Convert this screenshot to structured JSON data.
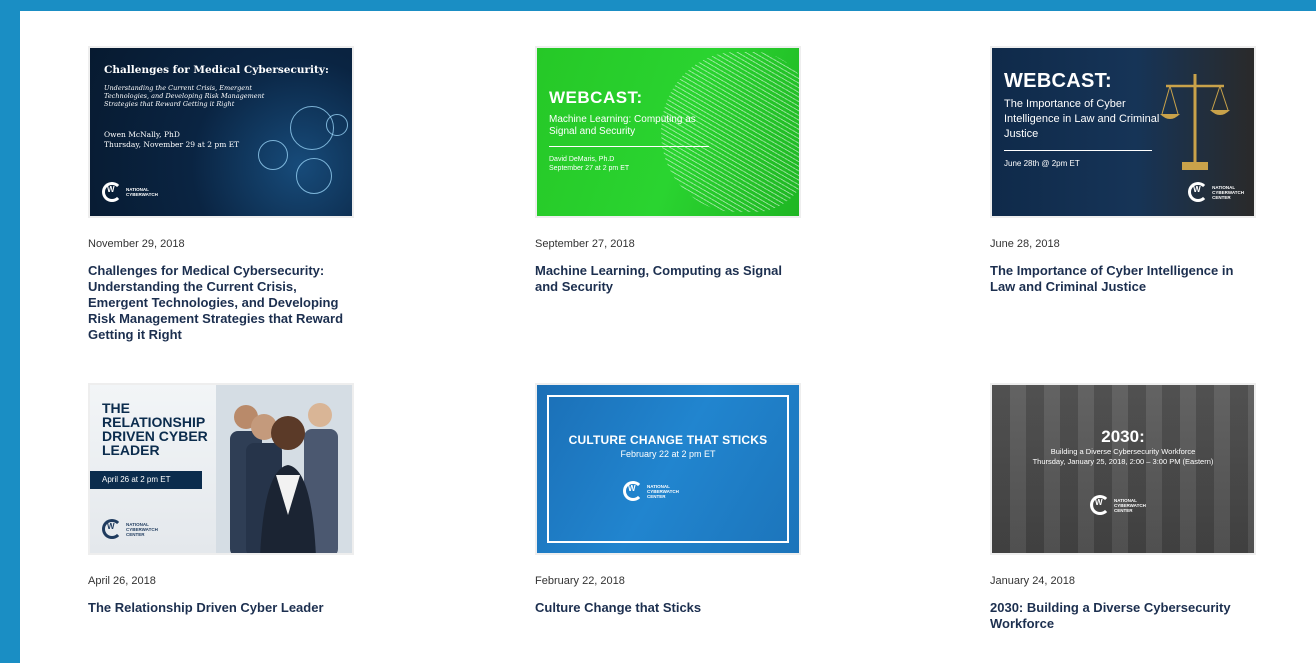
{
  "colors": {
    "frame": "#1a8ec4",
    "title": "#1c2f4f"
  },
  "cards": [
    {
      "date": "November 29, 2018",
      "title": "Challenges for Medical Cybersecurity: Understanding the Current Crisis, Emergent Technologies, and Developing Risk Management Strategies that Reward Getting it Right",
      "thumb": {
        "heading": "Challenges for Medical Cybersecurity:",
        "subheading": "Understanding the Current Crisis, Emergent Technologies, and Developing Risk Management Strategies that Reward Getting it Right",
        "presenter": "Owen McNally, PhD",
        "when": "Thursday, November 29 at 2 pm ET"
      }
    },
    {
      "date": "September 27, 2018",
      "title": "Machine Learning, Computing as Signal and Security",
      "thumb": {
        "heading": "WEBCAST:",
        "subheading": "Machine Learning: Computing as Signal and Security",
        "presenter": "David DeMaris, Ph.D",
        "when": "September 27 at 2 pm ET"
      }
    },
    {
      "date": "June 28, 2018",
      "title": "The Importance of Cyber Intelligence in Law and Criminal Justice",
      "thumb": {
        "heading": "WEBCAST:",
        "subheading": "The Importance of Cyber Intelligence in Law and Criminal Justice",
        "when": "June 28th @ 2pm ET"
      }
    },
    {
      "date": "April 26, 2018",
      "title": "The Relationship Driven Cyber Leader",
      "thumb": {
        "heading": "THE RELATIONSHIP DRIVEN CYBER LEADER",
        "when": "April 26 at 2 pm ET"
      }
    },
    {
      "date": "February 22, 2018",
      "title": "Culture Change that Sticks",
      "thumb": {
        "heading": "CULTURE CHANGE THAT STICKS",
        "when": "February 22 at 2 pm ET"
      }
    },
    {
      "date": "January 24, 2018",
      "title": "2030: Building a Diverse Cybersecurity Workforce",
      "thumb": {
        "heading": "2030:",
        "subheading": "Building a Diverse Cybersecurity Workforce",
        "when": "Thursday, January 25, 2018, 2:00 – 3:00 PM (Eastern)"
      }
    }
  ],
  "logo": {
    "line1": "NATIONAL",
    "line2": "CYBERWATCH",
    "line3": "CENTER"
  }
}
